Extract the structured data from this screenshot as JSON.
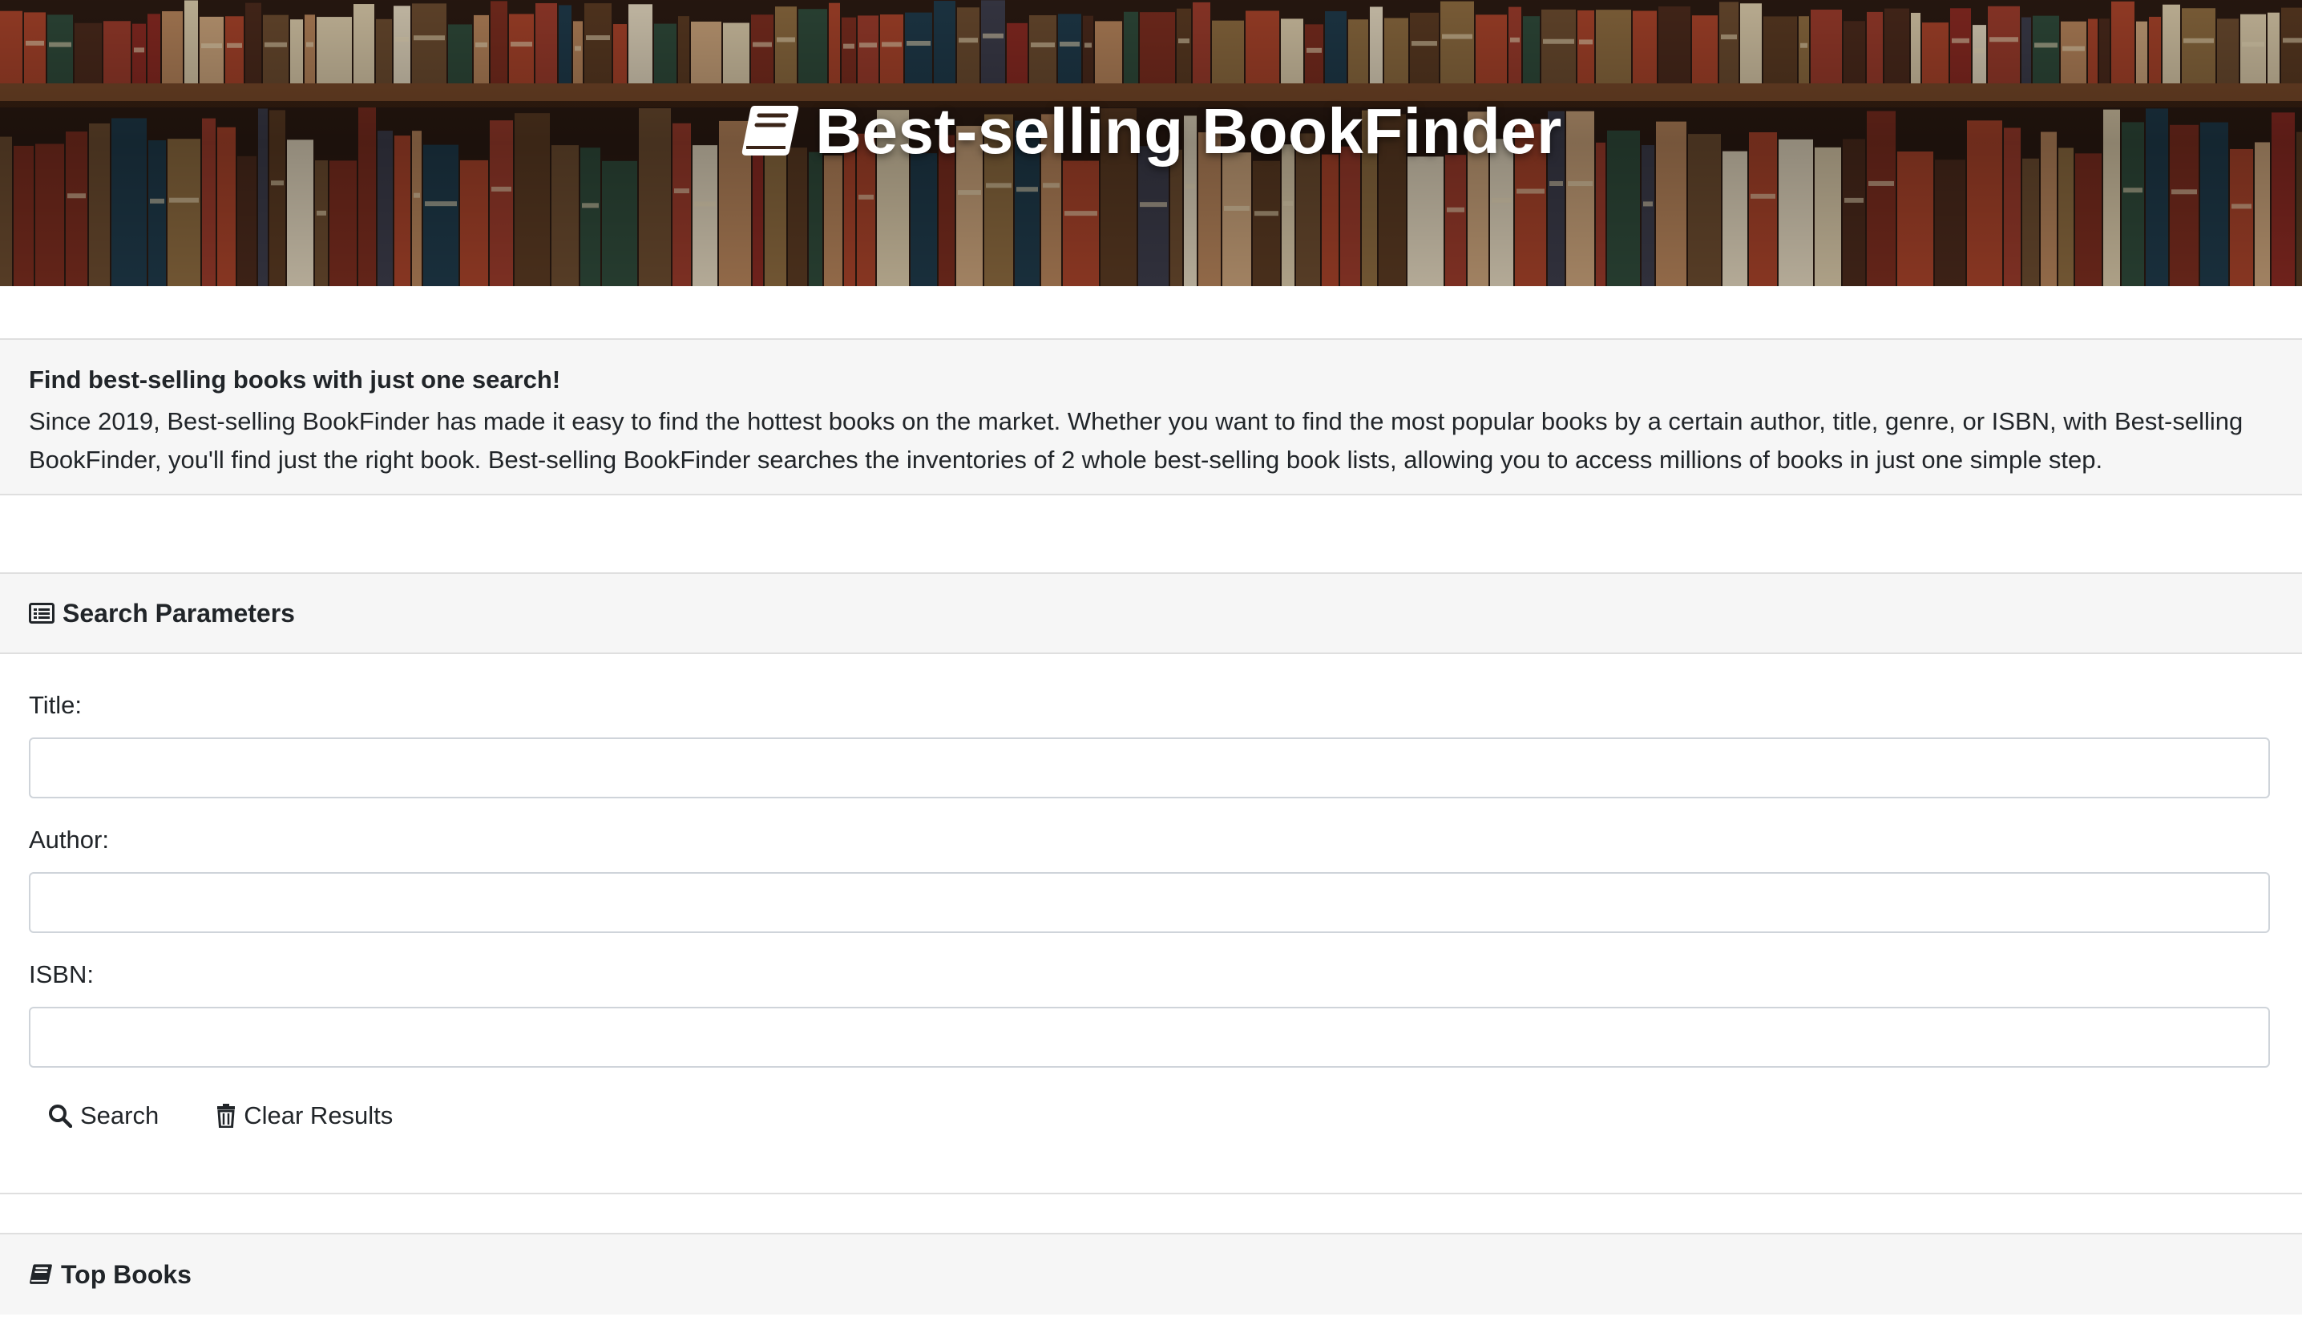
{
  "hero": {
    "title": "Best-selling BookFinder",
    "icon": "book-icon"
  },
  "intro": {
    "heading": "Find best-selling books with just one search!",
    "text": "Since 2019, Best-selling BookFinder has made it easy to find the hottest books on the market. Whether you want to find the most popular books by a certain author, title, genre, or ISBN, with Best-selling BookFinder, you'll find just the right book. Best-selling BookFinder searches the inventories of 2 whole best-selling book lists, allowing you to access millions of books in just one simple step."
  },
  "search": {
    "header": "Search Parameters",
    "header_icon": "list-icon",
    "fields": [
      {
        "label": "Title:",
        "value": "",
        "placeholder": ""
      },
      {
        "label": "Author:",
        "value": "",
        "placeholder": ""
      },
      {
        "label": "ISBN:",
        "value": "",
        "placeholder": ""
      }
    ],
    "search_label": "Search",
    "search_icon": "search-icon",
    "clear_label": "Clear Results",
    "clear_icon": "trash-icon"
  },
  "top_books": {
    "header": "Top Books",
    "header_icon": "book-icon"
  },
  "colors": {
    "card_bg": "#f6f6f6",
    "border": "#dfdfdf",
    "text": "#212529",
    "hero_text": "#ffffff"
  }
}
